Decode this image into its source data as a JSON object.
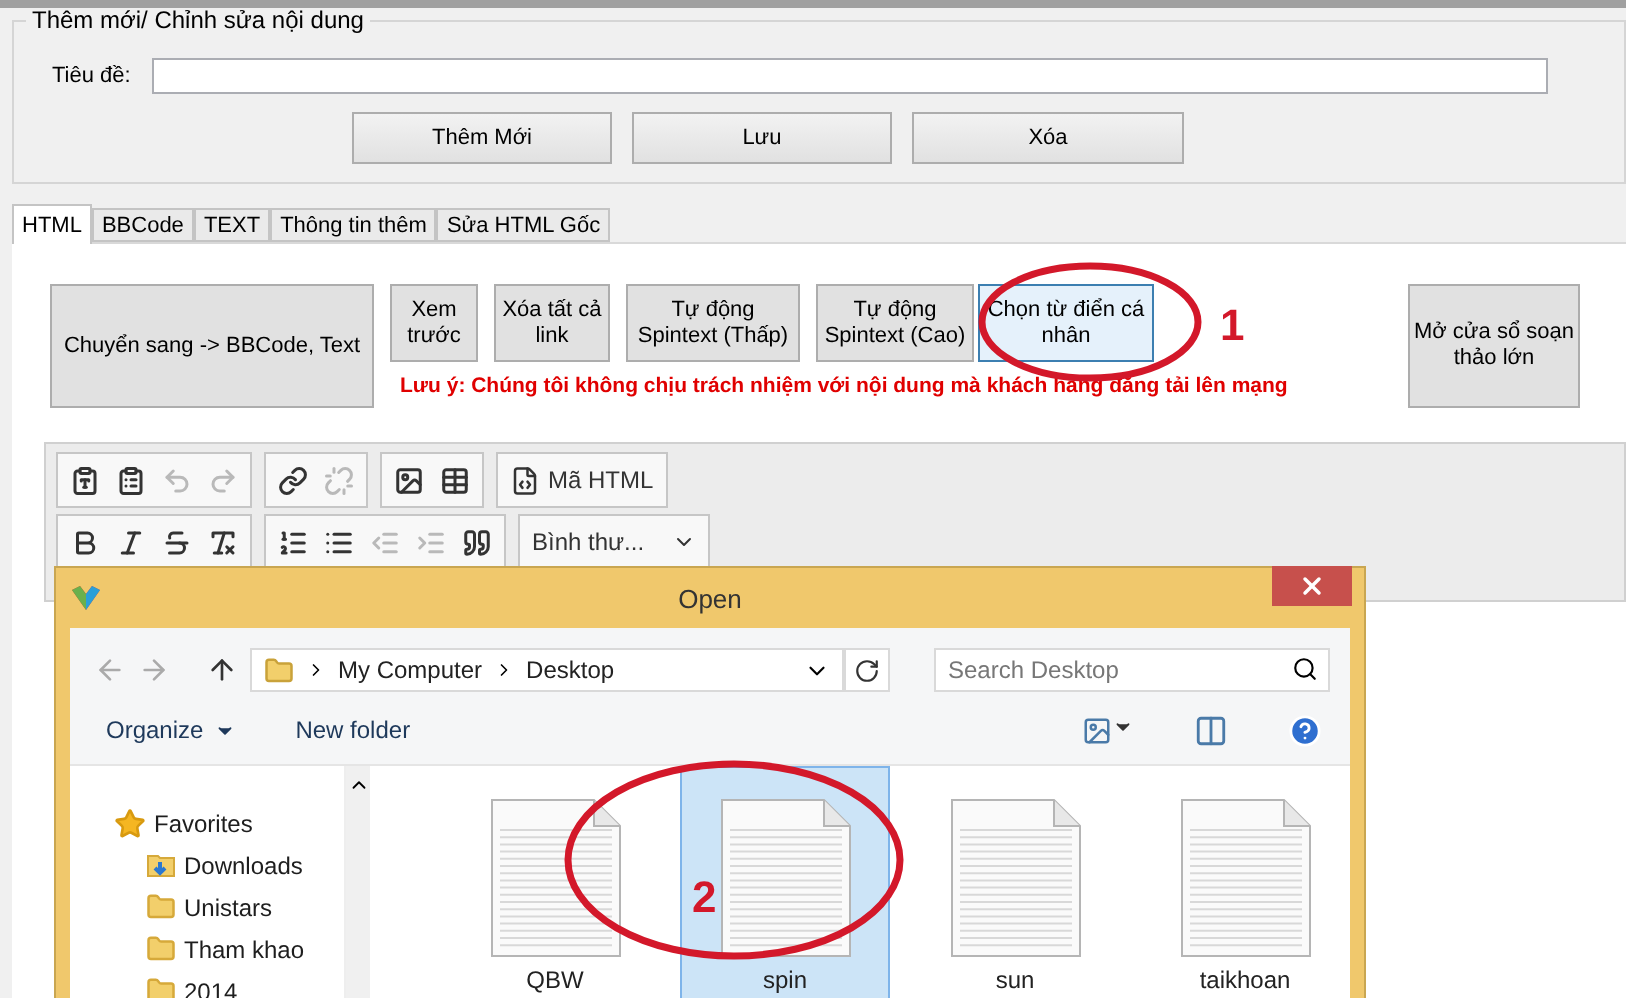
{
  "group": {
    "title": "Thêm mới/ Chỉnh sửa nội dung",
    "field_label": "Tiêu đề:",
    "buttons": [
      "Thêm Mới",
      "Lưu",
      "Xóa"
    ]
  },
  "tabs": [
    {
      "label": "HTML",
      "selected": true
    },
    {
      "label": "BBCode",
      "selected": false
    },
    {
      "label": "TEXT",
      "selected": false
    },
    {
      "label": "Thông tin thêm",
      "selected": false
    },
    {
      "label": "Sửa HTML Gốc",
      "selected": false
    }
  ],
  "actions": [
    {
      "label": "Chuyển sang -> BBCode, Text",
      "kind": "large",
      "focused": false
    },
    {
      "label": "Xem trước",
      "kind": "small",
      "focused": false
    },
    {
      "label": "Xóa tất cả link",
      "kind": "small",
      "focused": false
    },
    {
      "label": "Tự động Spintext (Thấp)",
      "kind": "small",
      "focused": false
    },
    {
      "label": "Tự động Spintext (Cao)",
      "kind": "small",
      "focused": false
    },
    {
      "label": "Chọn từ điển cá nhân",
      "kind": "small",
      "focused": true
    },
    {
      "label": "Mở cửa sổ soạn thảo lớn",
      "kind": "large",
      "focused": false
    }
  ],
  "notice": "Lưu ý: Chúng tôi không chịu trách nhiệm với nội dung mà khách hàng đăng tải lên mạng",
  "toolbar": [
    [
      [
        {
          "kind": "pastetext",
          "disabled": false
        },
        {
          "kind": "pasteword",
          "disabled": false
        },
        {
          "kind": "undo",
          "disabled": true
        },
        {
          "kind": "redo",
          "disabled": true
        }
      ],
      [
        {
          "kind": "link",
          "disabled": false
        },
        {
          "kind": "unlink",
          "disabled": true
        }
      ],
      [
        {
          "kind": "image",
          "disabled": false
        },
        {
          "kind": "table",
          "disabled": false
        }
      ],
      [
        {
          "kind": "source",
          "disabled": false,
          "label": "Mã HTML"
        }
      ]
    ],
    [
      [
        {
          "kind": "bold",
          "disabled": false
        },
        {
          "kind": "italic",
          "disabled": false
        },
        {
          "kind": "strike",
          "disabled": false
        },
        {
          "kind": "clearformat",
          "disabled": false
        }
      ],
      [
        {
          "kind": "numlist",
          "disabled": false
        },
        {
          "kind": "bullist",
          "disabled": false
        },
        {
          "kind": "outdent",
          "disabled": true
        },
        {
          "kind": "indent",
          "disabled": true
        },
        {
          "kind": "blockquote",
          "disabled": false
        }
      ],
      [
        {
          "kind": "format",
          "disabled": false,
          "label": "Bình thư..."
        }
      ]
    ]
  ],
  "dialog": {
    "title": "Open",
    "path": [
      "My Computer",
      "Desktop"
    ],
    "search_placeholder": "Search Desktop",
    "commands": [
      "Organize",
      "New folder"
    ],
    "nav": [
      {
        "label": "Favorites",
        "kind": "star",
        "children": [
          {
            "label": "Downloads",
            "kind": "download"
          },
          {
            "label": "Unistars",
            "kind": "folder"
          },
          {
            "label": "Tham khao",
            "kind": "folder"
          },
          {
            "label": "2014",
            "kind": "folder"
          }
        ]
      }
    ],
    "files": [
      {
        "name": "QBW",
        "selected": false
      },
      {
        "name": "spin",
        "selected": true
      },
      {
        "name": "sun",
        "selected": false
      },
      {
        "name": "taikhoan",
        "selected": false
      }
    ]
  },
  "annotations": [
    {
      "label": "1"
    },
    {
      "label": "2"
    }
  ]
}
